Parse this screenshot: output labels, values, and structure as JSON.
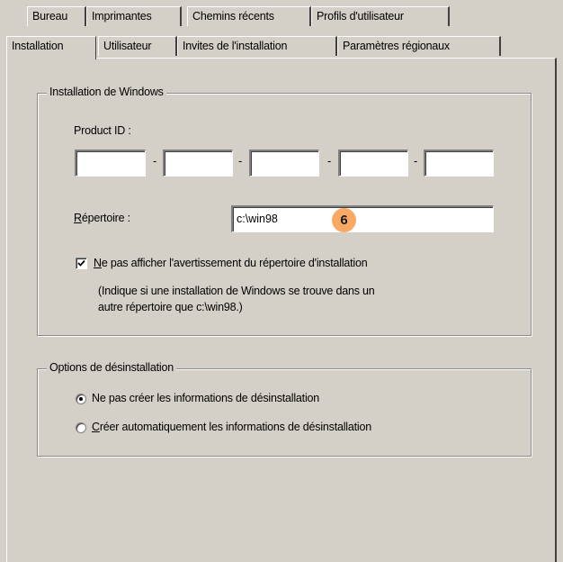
{
  "tabs_back": [
    "Bureau",
    "Imprimantes",
    "Chemins récents",
    "Profils d'utilisateur"
  ],
  "tabs_front": [
    "Installation",
    "Utilisateur",
    "Invites de l'installation",
    "Paramètres régionaux"
  ],
  "active_tab": "Installation",
  "install_group": {
    "legend": "Installation de Windows",
    "product_id_label": "Product ID :",
    "product_id_fields": [
      "",
      "",
      "",
      "",
      ""
    ],
    "directory_label_first": "R",
    "directory_label_rest": "épertoire :",
    "directory_value": "c:\\win98",
    "checkbox_checked": true,
    "checkbox_label_first": "N",
    "checkbox_label_rest": "e pas afficher l'avertissement du répertoire d'installation",
    "hint_line1": "(Indique si une  installation de Windows se trouve dans un",
    "hint_line2": "autre répertoire que c:\\win98.)"
  },
  "uninstall_group": {
    "legend": "Options de désinstallation",
    "option1": "Ne pas créer les informations de désinstallation",
    "option2_first": "C",
    "option2_rest": "réer automatiquement les informations de désinstallation",
    "selected": 1
  },
  "callout": "6",
  "colors": {
    "face": "#d4d0c8",
    "callout": "#f9a964"
  },
  "icons": {
    "check": "check-mark-icon",
    "radio_dot": "radio-dot-icon"
  }
}
